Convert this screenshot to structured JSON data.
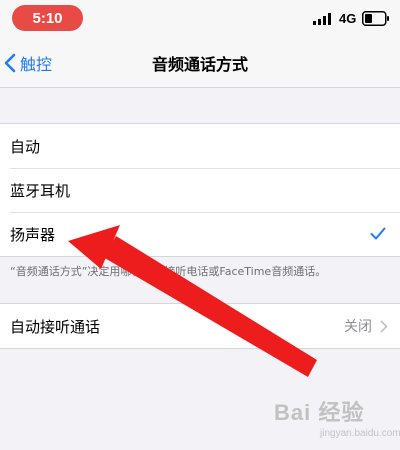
{
  "status_bar": {
    "time": "5:10",
    "network": "4G",
    "icons": [
      "signal-icon",
      "battery-icon"
    ]
  },
  "nav": {
    "back_label": "触控",
    "title": "音频通话方式",
    "back_icon": "chevron-left-icon"
  },
  "options": [
    {
      "label": "自动",
      "selected": false
    },
    {
      "label": "蓝牙耳机",
      "selected": false
    },
    {
      "label": "扬声器",
      "selected": true
    }
  ],
  "footer": "“音频通话方式”决定用哪种方式接听电话或FaceTime音频通话。",
  "auto_answer": {
    "label": "自动接听通话",
    "value": "关闭"
  },
  "watermark": {
    "text": "Bai 经验",
    "sub": "jingyan.baidu.com"
  },
  "colors": {
    "accent": "#1f7bf6",
    "time_pill": "#e84b46",
    "arrow": "#ee1d1d"
  }
}
